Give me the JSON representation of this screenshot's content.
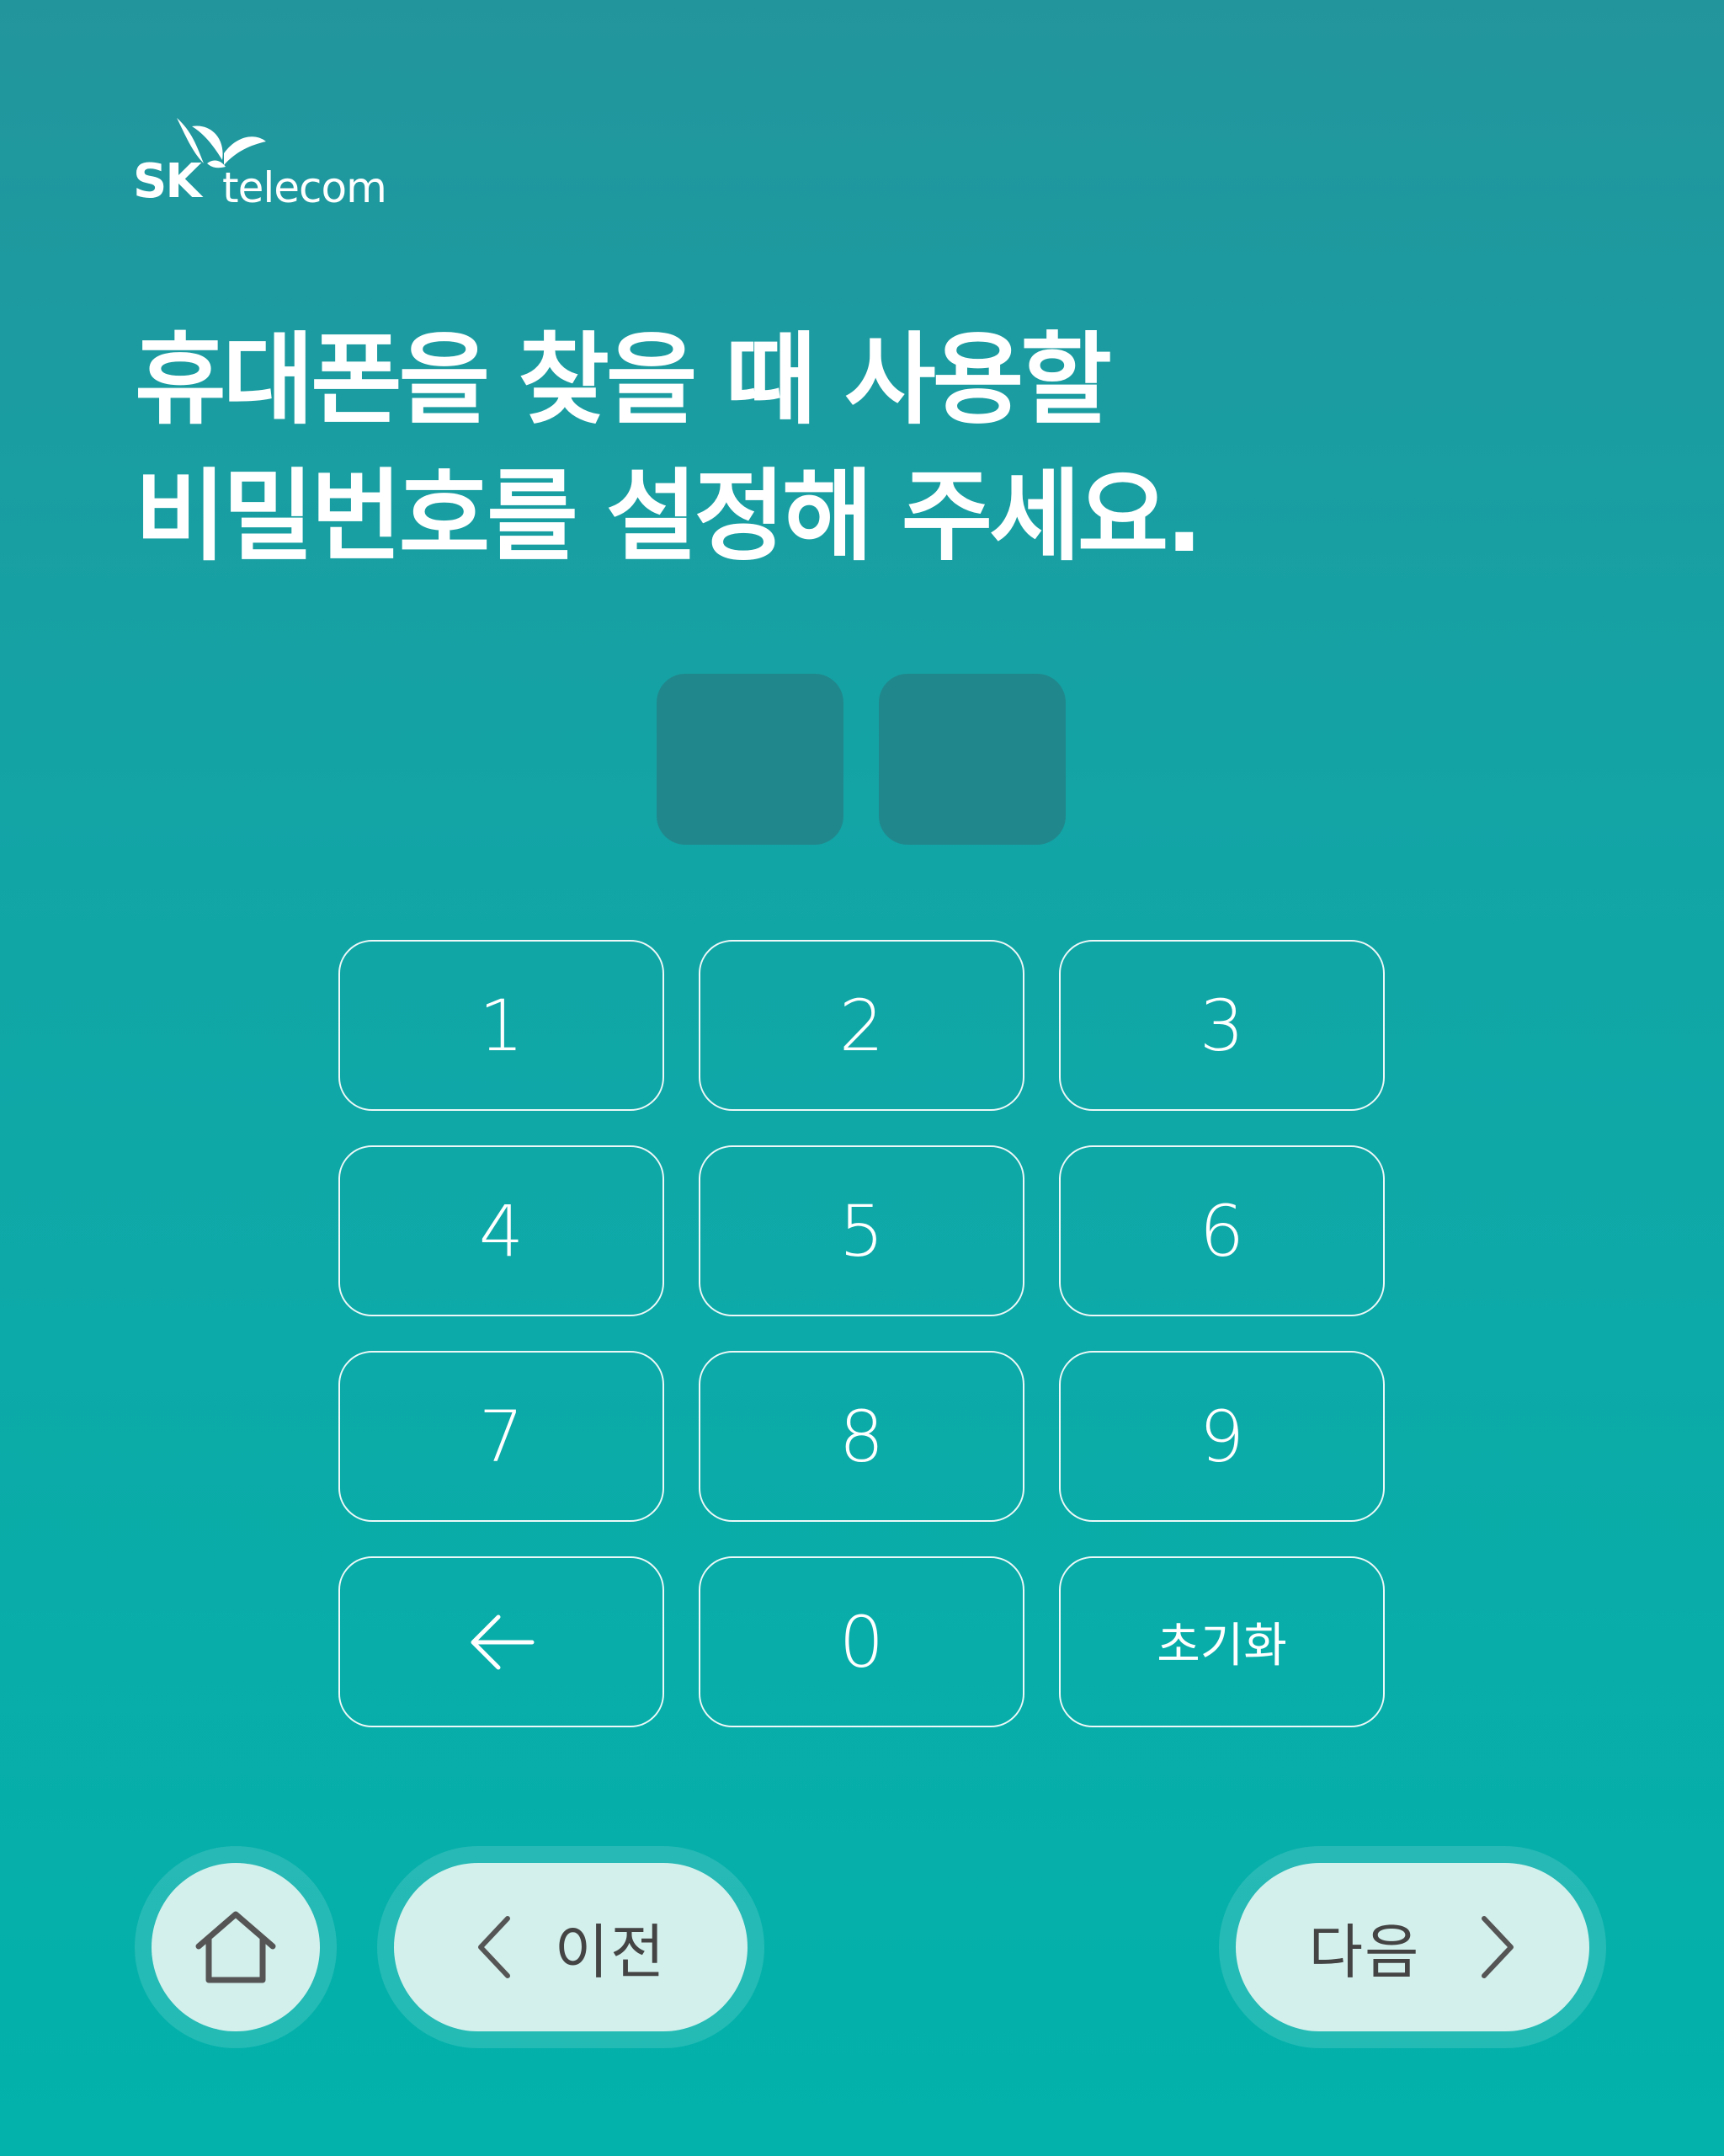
{
  "brand": {
    "logo_text_bold": "SK",
    "logo_text_light": "telecom",
    "name": "SK telecom"
  },
  "heading": {
    "line1": "휴대폰을 찾을 때 사용할",
    "line2": "비밀번호를 설정해 주세요."
  },
  "pin": {
    "slot_count": 2,
    "slot_color": "#20888d"
  },
  "keypad": {
    "keys": [
      "1",
      "2",
      "3",
      "4",
      "5",
      "6",
      "7",
      "8",
      "9",
      "backspace",
      "0",
      "초기화"
    ],
    "backspace_icon": "arrow-left-icon",
    "reset_label": "초기화"
  },
  "nav": {
    "home_icon": "home-icon",
    "prev_label": "이전",
    "prev_icon": "chevron-left-icon",
    "next_label": "다음",
    "next_icon": "chevron-right-icon"
  },
  "colors": {
    "bg_top": "#22959c",
    "bg_bottom": "#02b2ab",
    "nav_button": "#d3f0ec",
    "nav_text": "#444444"
  }
}
